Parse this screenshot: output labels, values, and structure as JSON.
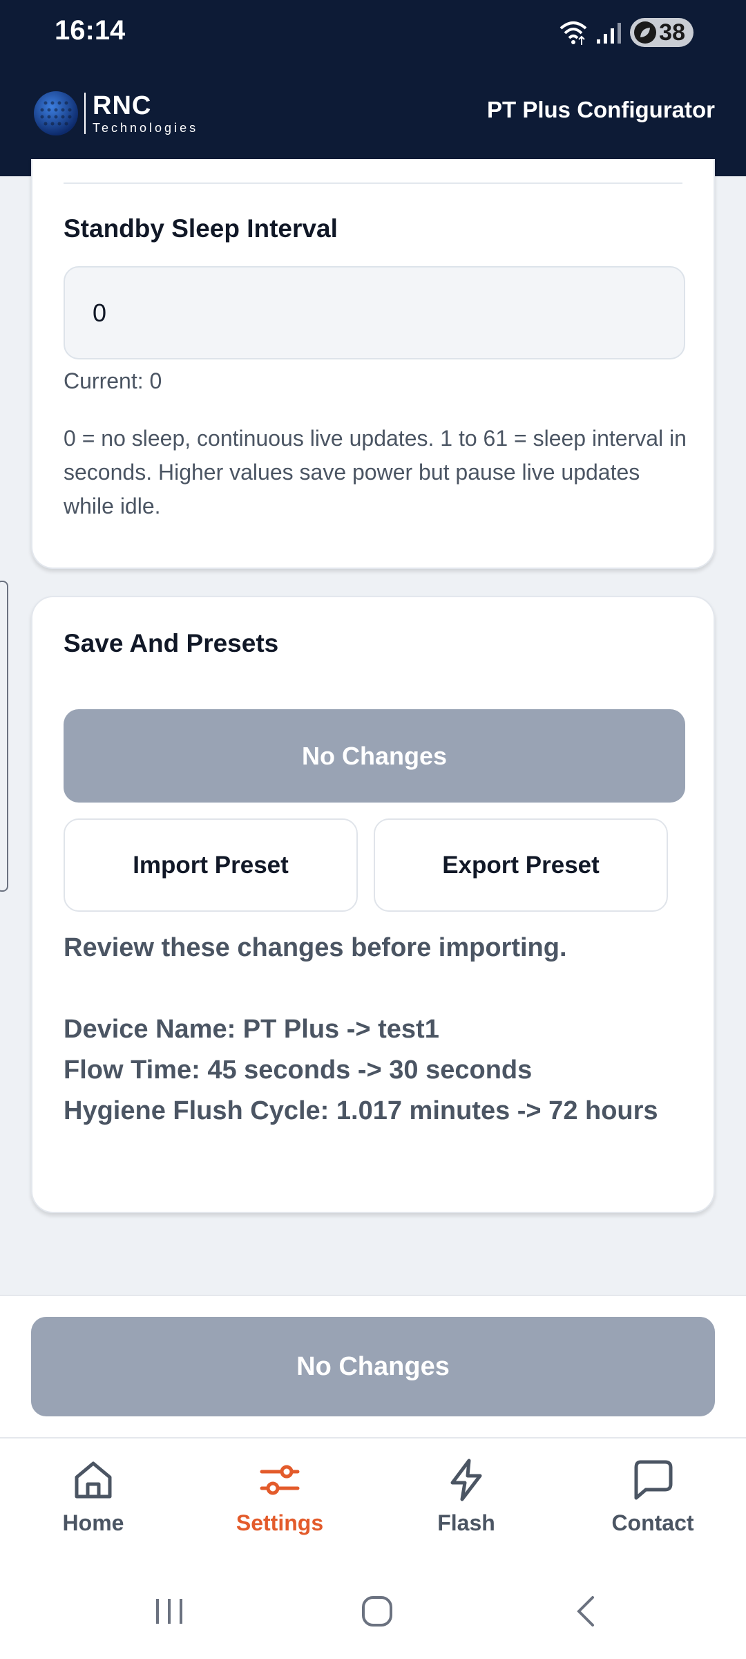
{
  "status_bar": {
    "time": "16:14",
    "battery": "38"
  },
  "header": {
    "logo_main": "RNC",
    "logo_sub": "Technologies",
    "title": "PT Plus Configurator"
  },
  "standby_card": {
    "title": "Standby Sleep Interval",
    "input_value": "0",
    "current": "Current: 0",
    "help": "0 = no sleep, continuous live updates. 1 to 61 = sleep interval in seconds. Higher values save power but pause live updates while idle."
  },
  "presets_card": {
    "title": "Save And Presets",
    "no_changes_label": "No Changes",
    "import_label": "Import Preset",
    "export_label": "Export Preset",
    "review_heading": "Review these changes before importing.",
    "changes": [
      "Device Name: PT Plus -> test1",
      "Flow Time: 45 seconds -> 30 seconds",
      "Hygiene Flush Cycle: 1.017 minutes -> 72 hours"
    ]
  },
  "save_bar": {
    "label": "No Changes"
  },
  "bottom_nav": {
    "items": [
      {
        "label": "Home",
        "icon": "home-icon"
      },
      {
        "label": "Settings",
        "icon": "sliders-icon",
        "active": true
      },
      {
        "label": "Flash",
        "icon": "lightning-icon"
      },
      {
        "label": "Contact",
        "icon": "message-icon"
      }
    ]
  },
  "colors": {
    "header_bg": "#0d1b36",
    "accent": "#e35b2b",
    "disabled_button": "#99a3b4",
    "page_bg": "#eef1f5"
  }
}
